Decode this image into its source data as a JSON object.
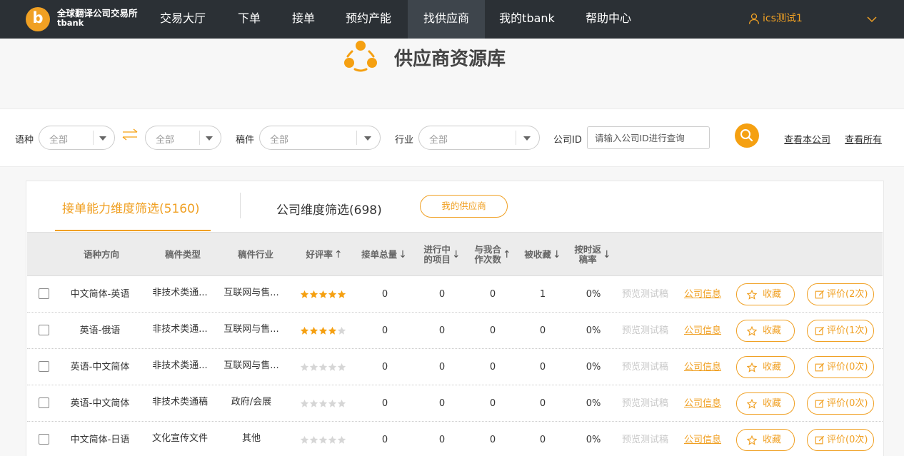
{
  "topnav": {
    "logo_cn": "全球翻译公司交易所",
    "logo_en": "tbank",
    "items": [
      {
        "label": "交易大厅",
        "active": false
      },
      {
        "label": "下单",
        "active": false
      },
      {
        "label": "接单",
        "active": false
      },
      {
        "label": "预约产能",
        "active": false
      },
      {
        "label": "找供应商",
        "active": true
      },
      {
        "label": "我的tbank",
        "active": false
      },
      {
        "label": "帮助中心",
        "active": false
      }
    ],
    "user": "ics测试1"
  },
  "header": {
    "title": "供应商资源库"
  },
  "filters": {
    "lang_label": "语种",
    "source_lang": "全部",
    "target_lang": "全部",
    "doc_label": "稿件",
    "doc_value": "全部",
    "industry_label": "行业",
    "industry_value": "全部",
    "company_id_label": "公司ID",
    "company_id_placeholder": "请输入公司ID进行查询",
    "view_own": "查看本公司",
    "view_all": "查看所有"
  },
  "panel": {
    "tab_capability": "接单能力维度筛选(5160)",
    "tab_company": "公司维度筛选(698)",
    "my_suppliers": "我的供应商",
    "columns": {
      "lang_direction": "语种方向",
      "doc_type": "稿件类型",
      "industry": "稿件行业",
      "rating": "好评率",
      "rating_arrow": "↑",
      "total_orders": "接单总量",
      "total_orders_arrow": "↓",
      "in_progress_1": "进行中",
      "in_progress_2": "的项目",
      "in_progress_arrow": "↓",
      "coop_1": "与我合",
      "coop_2": "作次数",
      "coop_arrow": "↑",
      "favorited": "被收藏",
      "favorited_arrow": "↓",
      "ontime_1": "按时返",
      "ontime_2": "稿率",
      "ontime_arrow": "↓"
    },
    "rows": [
      {
        "lang": "中文简体-英语",
        "doc": "非技术类通...",
        "industry": "互联网与售...",
        "rating": 5,
        "total": "0",
        "progress": "0",
        "coop": "0",
        "fav": "1",
        "ontime": "0%",
        "preview": "预览测试稿",
        "info": "公司信息",
        "collect": "收藏",
        "review": "评价(2次)"
      },
      {
        "lang": "英语-俄语",
        "doc": "非技术类通...",
        "industry": "互联网与售...",
        "rating": 4,
        "total": "0",
        "progress": "0",
        "coop": "0",
        "fav": "0",
        "ontime": "0%",
        "preview": "预览测试稿",
        "info": "公司信息",
        "collect": "收藏",
        "review": "评价(1次)"
      },
      {
        "lang": "英语-中文简体",
        "doc": "非技术类通...",
        "industry": "互联网与售...",
        "rating": 0,
        "total": "0",
        "progress": "0",
        "coop": "0",
        "fav": "0",
        "ontime": "0%",
        "preview": "预览测试稿",
        "info": "公司信息",
        "collect": "收藏",
        "review": "评价(0次)"
      },
      {
        "lang": "英语-中文简体",
        "doc": "非技术类通稿",
        "industry": "政府/会展",
        "rating": 0,
        "total": "0",
        "progress": "0",
        "coop": "0",
        "fav": "0",
        "ontime": "0%",
        "preview": "预览测试稿",
        "info": "公司信息",
        "collect": "收藏",
        "review": "评价(0次)"
      },
      {
        "lang": "中文简体-日语",
        "doc": "文化宣传文件",
        "industry": "其他",
        "rating": 0,
        "total": "0",
        "progress": "0",
        "coop": "0",
        "fav": "0",
        "ontime": "0%",
        "preview": "预览测试稿",
        "info": "公司信息",
        "collect": "收藏",
        "review": "评价(0次)"
      }
    ]
  },
  "colors": {
    "accent": "#f0a023",
    "nav_bg": "#2b3035",
    "star_on": "#f5a011",
    "star_off": "#d6d6d6"
  },
  "icons": {
    "logo": "tbank-logo-icon",
    "user": "user-icon",
    "dropdown": "chevron-down-icon",
    "brand": "network-nodes-icon",
    "swap": "swap-arrows-icon",
    "search": "search-icon",
    "collect": "star-outline-icon",
    "review": "edit-icon"
  }
}
